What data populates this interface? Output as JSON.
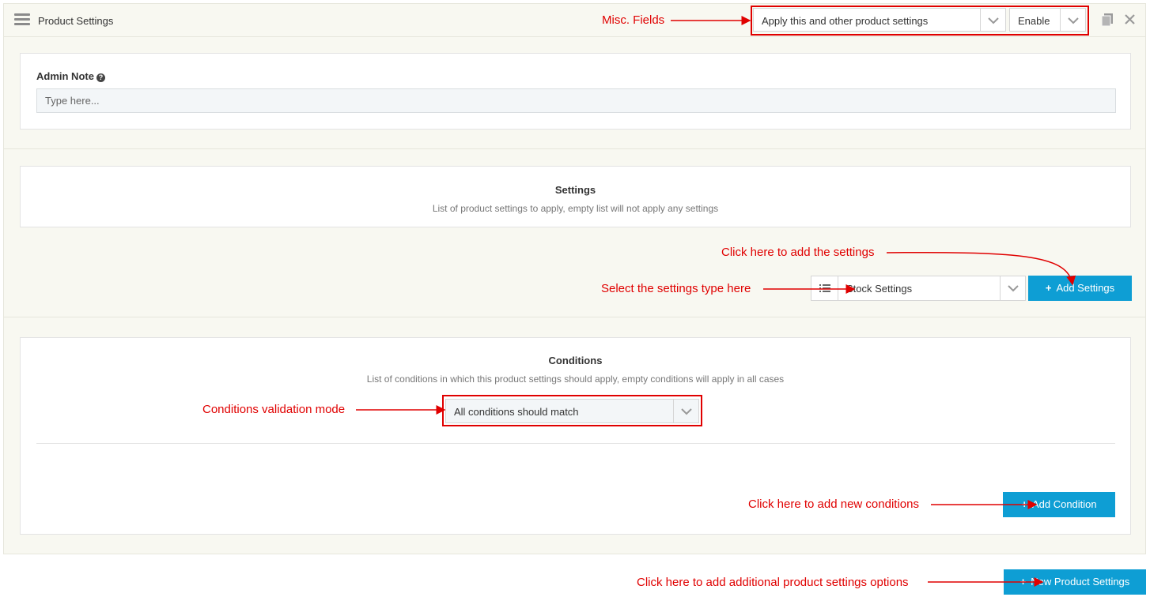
{
  "header": {
    "title": "Product Settings",
    "apply_select_value": "Apply this and other product settings",
    "status_select_value": "Enable"
  },
  "admin_note": {
    "label": "Admin Note",
    "placeholder": "Type here..."
  },
  "settings": {
    "title": "Settings",
    "description": "List of product settings to apply, empty list will not apply any settings",
    "type_select_value": "Stock Settings",
    "add_button_label": "Add Settings"
  },
  "conditions": {
    "title": "Conditions",
    "description": "List of conditions in which this product settings should apply, empty conditions will apply in all cases",
    "mode_select_value": "All conditions should match",
    "add_button_label": "Add Condition"
  },
  "footer": {
    "new_button_label": "New Product Settings"
  },
  "annotations": {
    "misc_fields": "Misc. Fields",
    "add_settings_hint": "Click here to add the settings",
    "select_type_hint": "Select the settings type here",
    "conditions_mode_hint": "Conditions validation mode",
    "add_conditions_hint": "Click here to add new conditions",
    "add_product_settings_hint": "Click here to add additional product settings options"
  },
  "colors": {
    "accent": "#0e9ed4",
    "annotation": "#e00000",
    "panel_bg": "#f8f8f1"
  }
}
